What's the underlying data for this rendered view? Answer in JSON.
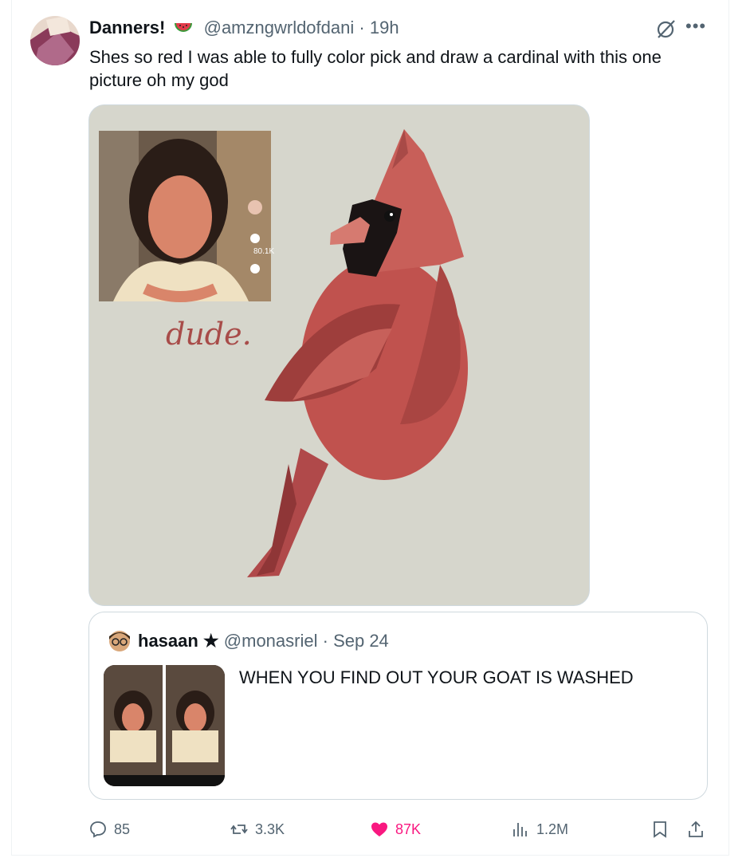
{
  "author": {
    "display_name": "Danners!",
    "handle": "@amzngwrldofdani",
    "separator": "·",
    "time": "19h"
  },
  "tweet_text": "Shes so red I was able to fully color pick and draw a cardinal with this one picture oh my god",
  "media": {
    "caption": "dude.",
    "inset_like_count": "80.1K"
  },
  "quoted": {
    "display_name": "hasaan ★",
    "handle": "@monasriel",
    "separator": "·",
    "date": "Sep 24",
    "text": "WHEN YOU FIND OUT YOUR GOAT IS WASHED"
  },
  "actions": {
    "replies": "85",
    "reposts": "3.3K",
    "likes": "87K",
    "views": "1.2M"
  },
  "colors": {
    "accent_like": "#f91880",
    "muted": "#536471",
    "media_bg": "#d6d6cc",
    "cardinal": "#c0524e"
  },
  "icons": [
    "watermelon-icon",
    "grok-icon",
    "more-icon",
    "reply-icon",
    "repost-icon",
    "like-icon",
    "views-icon",
    "bookmark-icon",
    "share-icon"
  ]
}
